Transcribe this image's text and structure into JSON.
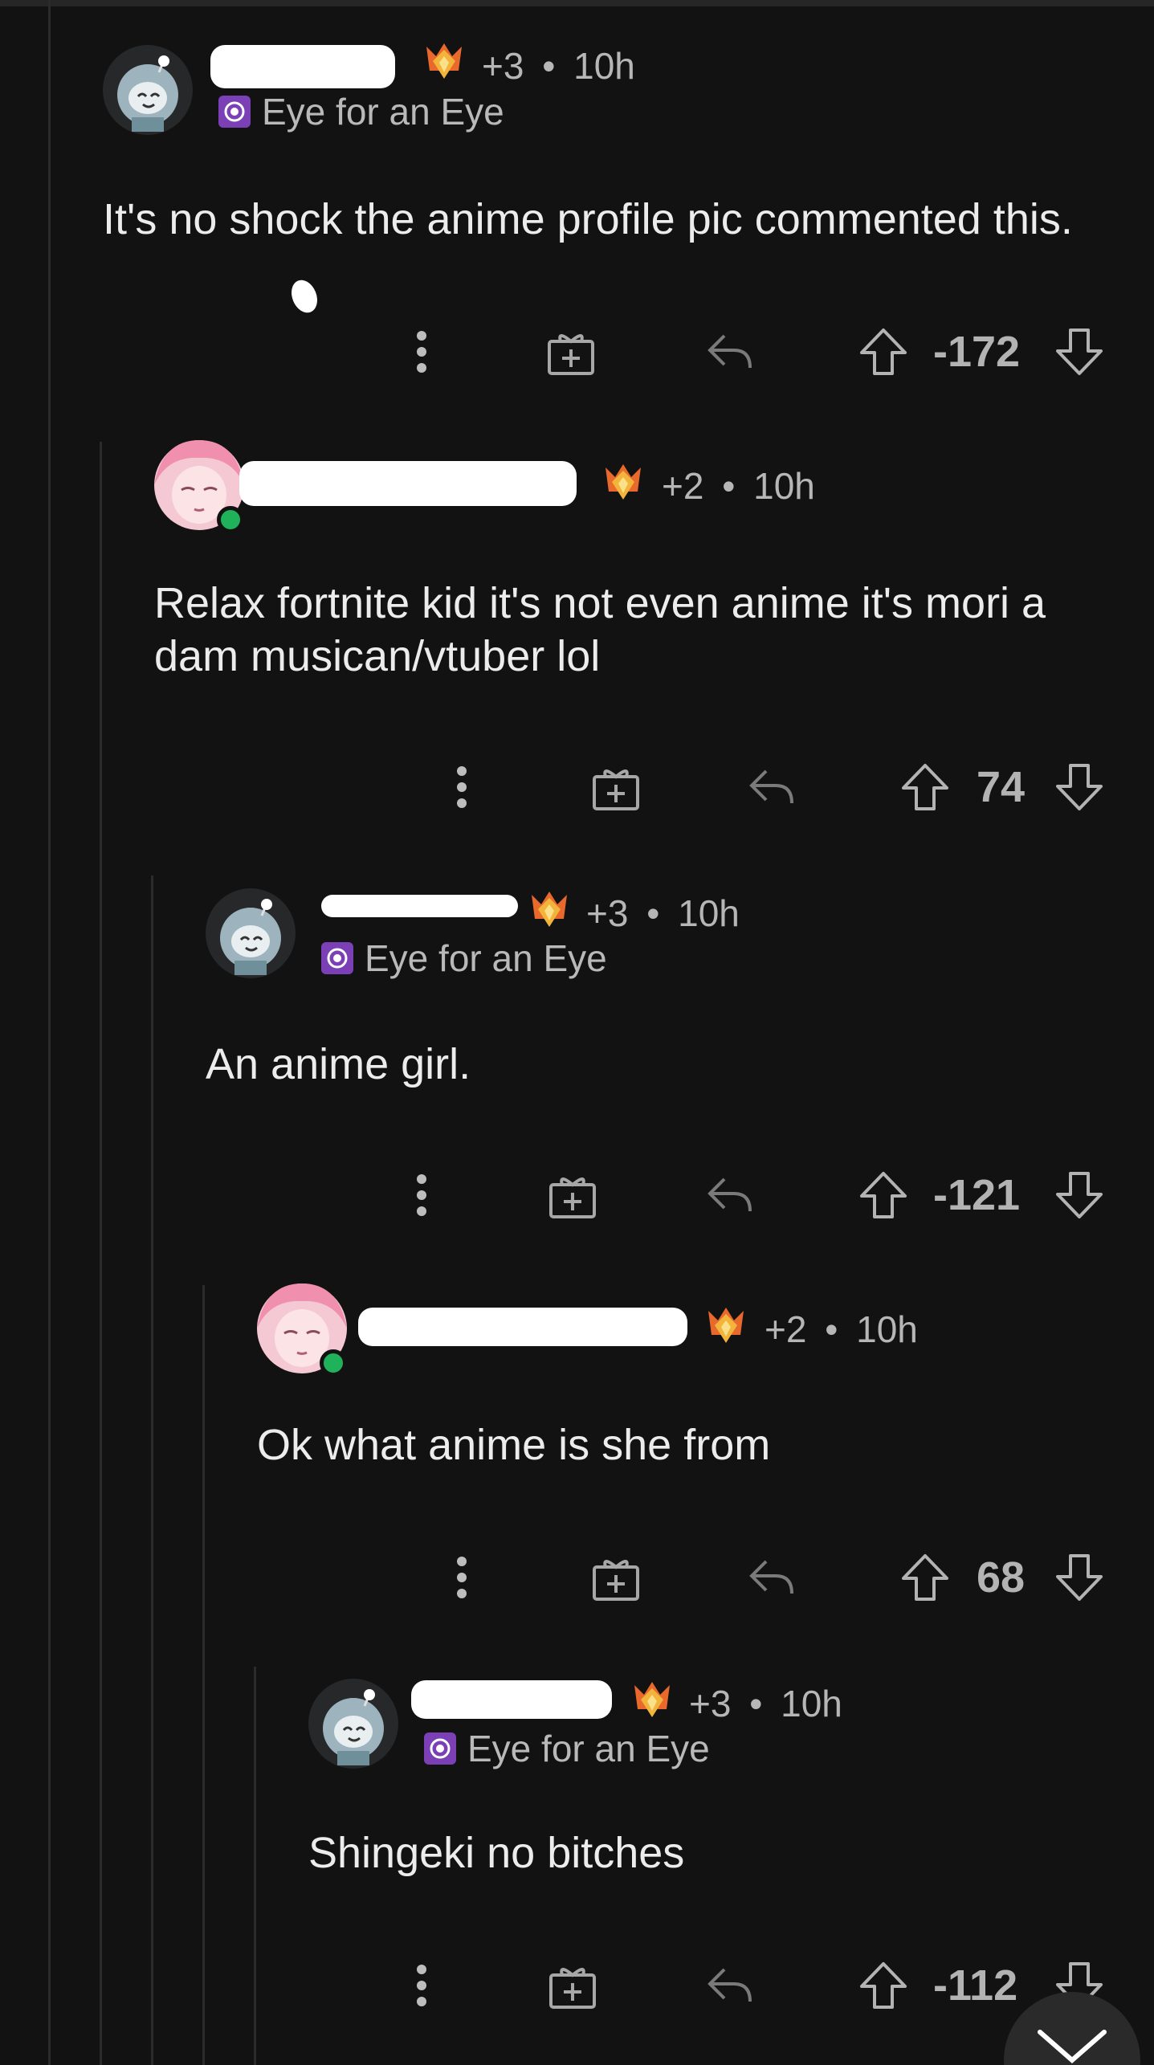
{
  "comments": [
    {
      "award_count": "+3",
      "sep": "•",
      "time": "10h",
      "flair": "Eye for an Eye",
      "text": "It's no shock the anime profile pic commented this.",
      "score": "-172"
    },
    {
      "award_count": "+2",
      "sep": "•",
      "time": "10h",
      "flair": "",
      "text": "Relax fortnite kid it's not even anime it's mori a dam musican/vtuber lol",
      "score": "74"
    },
    {
      "award_count": "+3",
      "sep": "•",
      "time": "10h",
      "flair": "Eye for an Eye",
      "text": "An anime girl.",
      "score": "-121"
    },
    {
      "award_count": "+2",
      "sep": "•",
      "time": "10h",
      "flair": "",
      "text": "Ok what anime is she from",
      "score": "68"
    },
    {
      "award_count": "+3",
      "sep": "•",
      "time": "10h",
      "flair": "Eye for an Eye",
      "text": "Shingeki no bitches",
      "score": "-112"
    }
  ],
  "icons": {
    "more": "more-vertical-icon",
    "award": "gift-icon",
    "reply": "reply-icon",
    "upvote": "upvote-arrow-icon",
    "downvote": "downvote-arrow-icon",
    "scroll": "chevron-down-icon"
  },
  "colors": {
    "background": "#121212",
    "text": "#ececec",
    "meta": "#b6b6b6",
    "flair_badge": "#7b3fb6",
    "online": "#1fb25a"
  }
}
